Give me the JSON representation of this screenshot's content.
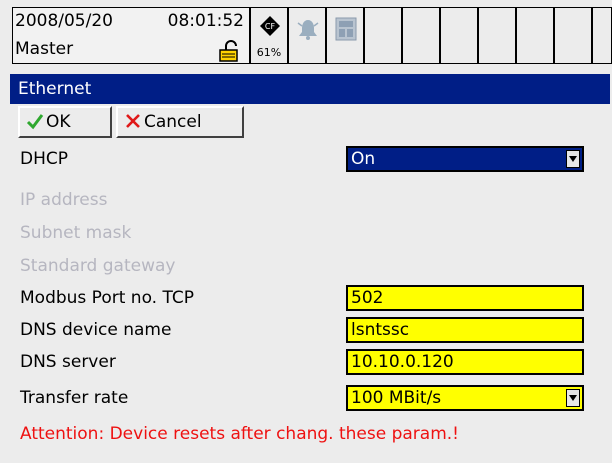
{
  "status": {
    "date": "2008/05/20",
    "time": "08:01:52",
    "user": "Master",
    "memory_percent": "61%"
  },
  "window": {
    "title": "Ethernet"
  },
  "toolbar": {
    "ok_label": "OK",
    "cancel_label": "Cancel"
  },
  "form": {
    "dhcp": {
      "label": "DHCP",
      "value": "On"
    },
    "ip_address": {
      "label": "IP address"
    },
    "subnet_mask": {
      "label": "Subnet mask"
    },
    "standard_gateway": {
      "label": "Standard gateway"
    },
    "modbus_port": {
      "label": "Modbus Port no. TCP",
      "value": "502"
    },
    "dns_device_name": {
      "label": "DNS device name",
      "value": "lsntssc"
    },
    "dns_server": {
      "label": "DNS server",
      "value": "10.10.0.120"
    },
    "transfer_rate": {
      "label": "Transfer rate",
      "value": "100 MBit/s"
    }
  },
  "attention_text": "Attention: Device resets after chang. these param.!",
  "colors": {
    "title_bar": "#001e86",
    "field_yellow": "#ffff00",
    "attention_red": "#ee1111",
    "disabled_text": "#b6b6c0"
  }
}
